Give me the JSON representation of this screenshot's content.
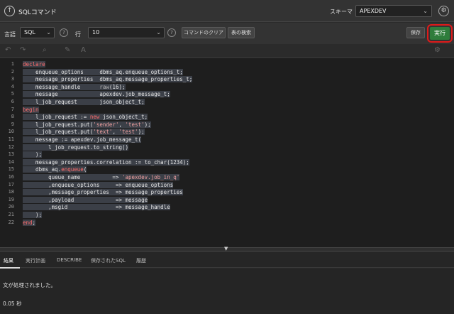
{
  "header": {
    "title": "SQLコマンド",
    "schema_label": "スキーマ",
    "schema_value": "APEXDEV"
  },
  "toolbar": {
    "language_label": "言語",
    "language_value": "SQL",
    "rows_label": "行",
    "rows_value": "10",
    "clear_command_label": "コマンドのクリア",
    "find_tables_label": "表の検索",
    "save_label": "保存",
    "run_label": "実行"
  },
  "editor": {
    "lines": [
      {
        "n": "1",
        "parts": [
          [
            "declare",
            "#ff6b6b"
          ]
        ]
      },
      {
        "n": "2",
        "parts": [
          [
            "    enqueue_options     dbms_aq.enqueue_options_t;",
            ""
          ]
        ]
      },
      {
        "n": "3",
        "parts": [
          [
            "    message_properties  dbms_aq.message_properties_t;",
            ""
          ]
        ]
      },
      {
        "n": "4",
        "parts": [
          [
            "    message_handle      ",
            ""
          ],
          [
            "raw",
            "#b8b8b8"
          ],
          [
            "(16);",
            ""
          ]
        ]
      },
      {
        "n": "5",
        "parts": [
          [
            "    message             apexdev.job_message_t;",
            ""
          ]
        ]
      },
      {
        "n": "6",
        "parts": [
          [
            "    l_job_request       json_object_t;",
            ""
          ]
        ]
      },
      {
        "n": "7",
        "parts": [
          [
            "begin",
            "#ff6b6b"
          ]
        ]
      },
      {
        "n": "8",
        "parts": [
          [
            "    l_job_request := ",
            ""
          ],
          [
            "new",
            "#ff6b6b"
          ],
          [
            " json_object_t;",
            ""
          ]
        ]
      },
      {
        "n": "9",
        "parts": [
          [
            "    l_job_request.put(",
            ""
          ],
          [
            "'sender'",
            "#f0a0a0"
          ],
          [
            ", ",
            ""
          ],
          [
            "'test'",
            "#f0a0a0"
          ],
          [
            ");",
            ""
          ]
        ]
      },
      {
        "n": "10",
        "parts": [
          [
            "    l_job_request.put(",
            ""
          ],
          [
            "'text'",
            "#f0a0a0"
          ],
          [
            ", ",
            ""
          ],
          [
            "'test'",
            "#f0a0a0"
          ],
          [
            ");",
            ""
          ]
        ]
      },
      {
        "n": "11",
        "parts": [
          [
            "    message := apexdev.job_message_t(",
            ""
          ]
        ]
      },
      {
        "n": "12",
        "parts": [
          [
            "        l_job_request.to_string()",
            ""
          ]
        ]
      },
      {
        "n": "13",
        "parts": [
          [
            "    );",
            ""
          ]
        ]
      },
      {
        "n": "14",
        "parts": [
          [
            "    message_properties.correlation := to_char(1234);",
            ""
          ]
        ]
      },
      {
        "n": "15",
        "parts": [
          [
            "    dbms_aq.",
            ""
          ],
          [
            "enqueue",
            "#ff6b6b"
          ],
          [
            "(",
            ""
          ]
        ]
      },
      {
        "n": "16",
        "parts": [
          [
            "        queue_name          => ",
            ""
          ],
          [
            "'apexdev.job_in_q'",
            "#f0a0a0"
          ]
        ]
      },
      {
        "n": "17",
        "parts": [
          [
            "        ,enqueue_options     => enqueue_options",
            ""
          ]
        ]
      },
      {
        "n": "18",
        "parts": [
          [
            "        ,message_properties  => message_properties",
            ""
          ]
        ]
      },
      {
        "n": "19",
        "parts": [
          [
            "        ,payload             => message",
            ""
          ]
        ]
      },
      {
        "n": "20",
        "parts": [
          [
            "        ,msgid               => message_handle",
            ""
          ]
        ]
      },
      {
        "n": "21",
        "parts": [
          [
            "    );",
            ""
          ]
        ]
      },
      {
        "n": "22",
        "parts": [
          [
            "end",
            "#ff6b6b"
          ],
          [
            ";",
            ""
          ]
        ]
      }
    ]
  },
  "tabs": [
    {
      "label": "結果",
      "active": true
    },
    {
      "label": "実行計画",
      "active": false
    },
    {
      "label": "DESCRIBE",
      "active": false
    },
    {
      "label": "保存されたSQL",
      "active": false
    },
    {
      "label": "履歴",
      "active": false
    }
  ],
  "results": {
    "message": "文が処理されました。",
    "elapsed": "0.05 秒"
  },
  "colors": {
    "run_button": "#2f7d3c",
    "highlight": "#e01a1a",
    "keyword": "#ff6b6b",
    "string": "#f0a0a0"
  }
}
